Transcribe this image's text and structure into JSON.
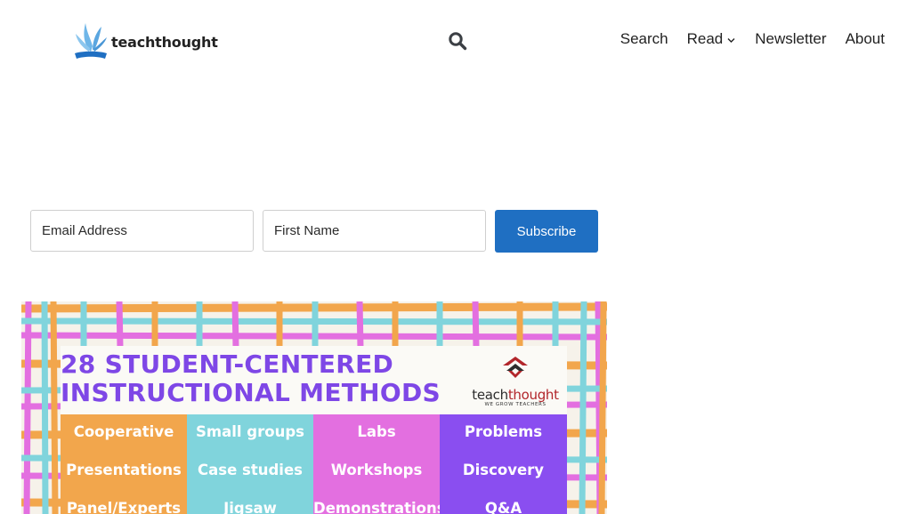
{
  "header": {
    "logo_text": "teachthought",
    "nav": [
      {
        "label": "Search"
      },
      {
        "label": "Read"
      },
      {
        "label": "Newsletter"
      },
      {
        "label": "About"
      }
    ]
  },
  "subscribe_form": {
    "email_placeholder": "Email Address",
    "first_name_placeholder": "First Name",
    "button_label": "Subscribe"
  },
  "infographic": {
    "title_line1": "28 STUDENT-CENTERED",
    "title_line2": "INSTRUCTIONAL METHODS",
    "brand_name_a": "teach",
    "brand_name_b": "thought",
    "brand_tagline": "WE GROW TEACHERS",
    "columns": [
      {
        "color": "#f2a64c",
        "items": [
          "Cooperative",
          "Presentations",
          "Panel/Experts"
        ]
      },
      {
        "color": "#80d4dc",
        "items": [
          "Small groups",
          "Case studies",
          "Jigsaw"
        ]
      },
      {
        "color": "#e36fe0",
        "items": [
          "Labs",
          "Workshops",
          "Demonstrations"
        ]
      },
      {
        "color": "#8a4ef0",
        "items": [
          "Problems",
          "Discovery",
          "Q&A"
        ]
      }
    ]
  },
  "colors": {
    "accent_blue": "#1f6fc2",
    "logo_light_blue": "#6fb6e8",
    "title_purple": "#7e47e6",
    "brand_red": "#b2262b"
  }
}
